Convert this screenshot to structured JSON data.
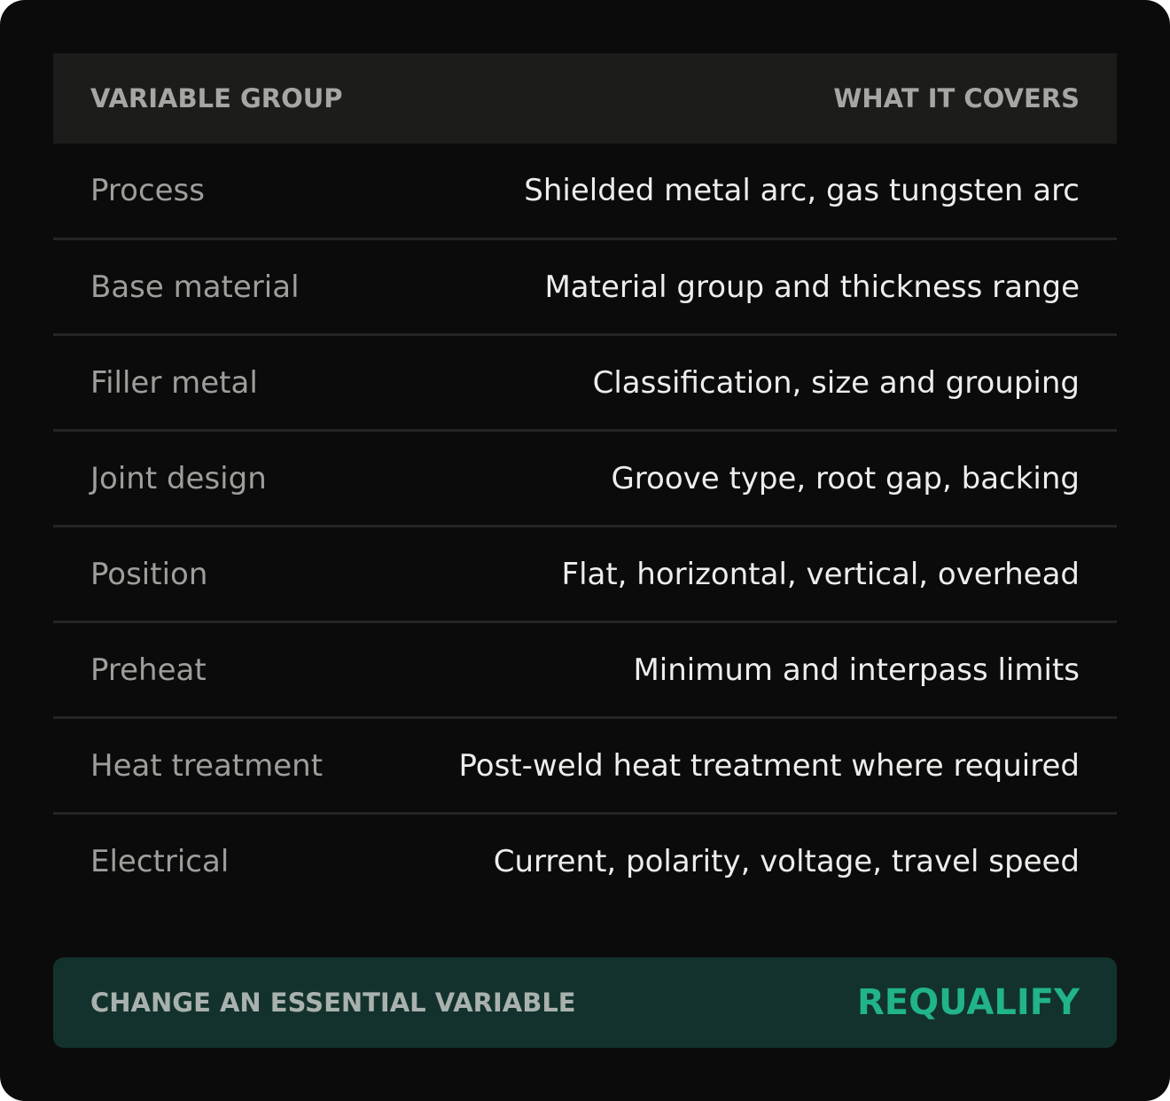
{
  "table": {
    "headers": {
      "group": "VARIABLE GROUP",
      "covers": "WHAT IT COVERS"
    },
    "rows": [
      {
        "group": "Process",
        "covers": "Shielded metal arc, gas tungsten arc"
      },
      {
        "group": "Base material",
        "covers": "Material group and thickness range"
      },
      {
        "group": "Filler metal",
        "covers": "Classification, size and grouping"
      },
      {
        "group": "Joint design",
        "covers": "Groove type, root gap, backing"
      },
      {
        "group": "Position",
        "covers": "Flat, horizontal, vertical, overhead"
      },
      {
        "group": "Preheat",
        "covers": "Minimum and interpass limits"
      },
      {
        "group": "Heat treatment",
        "covers": "Post-weld heat treatment where required"
      },
      {
        "group": "Electrical",
        "covers": "Current, polarity, voltage, travel speed"
      }
    ]
  },
  "banner": {
    "label": "CHANGE AN ESSENTIAL VARIABLE",
    "action": "REQUALIFY"
  },
  "colors": {
    "background": "#0b0b0b",
    "header_bg": "#1c1c1b",
    "banner_bg": "#13322d",
    "accent": "#21b389"
  }
}
